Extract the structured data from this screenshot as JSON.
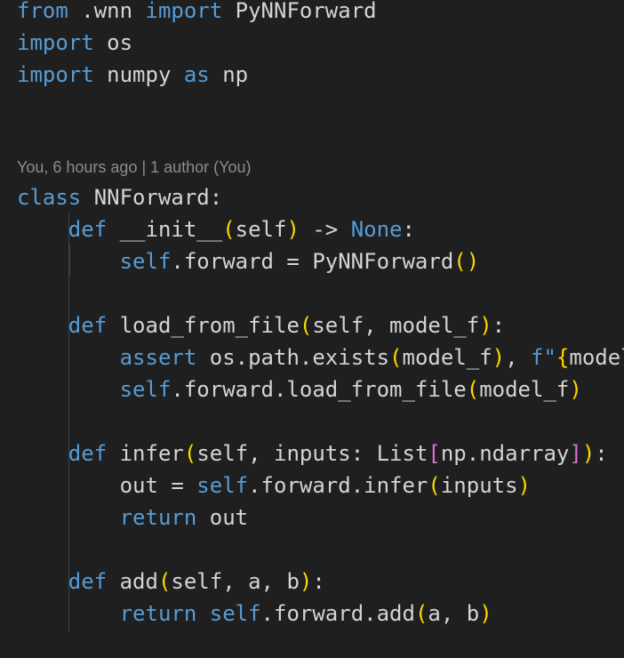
{
  "blame_annotation": "You, 6 hours ago | 1 author (You)",
  "code_lines": [
    {
      "tokens": [
        {
          "t": "from",
          "c": "kw"
        },
        {
          "t": " .wnn ",
          "c": "plain"
        },
        {
          "t": "import",
          "c": "kw"
        },
        {
          "t": " PyNNForward",
          "c": "plain"
        }
      ]
    },
    {
      "tokens": [
        {
          "t": "import",
          "c": "kw"
        },
        {
          "t": " os",
          "c": "plain"
        }
      ]
    },
    {
      "tokens": [
        {
          "t": "import",
          "c": "kw"
        },
        {
          "t": " numpy ",
          "c": "plain"
        },
        {
          "t": "as",
          "c": "kw"
        },
        {
          "t": " np",
          "c": "plain"
        }
      ]
    },
    {
      "tokens": [
        {
          "t": "class",
          "c": "kw"
        },
        {
          "t": " NNForward:",
          "c": "plain"
        }
      ]
    },
    {
      "tokens": [
        {
          "t": "    ",
          "c": "plain"
        },
        {
          "t": "def",
          "c": "kw"
        },
        {
          "t": " __init__",
          "c": "plain"
        },
        {
          "t": "(",
          "c": "b1"
        },
        {
          "t": "self",
          "c": "plain"
        },
        {
          "t": ")",
          "c": "b1"
        },
        {
          "t": " -> ",
          "c": "plain"
        },
        {
          "t": "None",
          "c": "kw"
        },
        {
          "t": ":",
          "c": "plain"
        }
      ]
    },
    {
      "tokens": [
        {
          "t": "        ",
          "c": "plain"
        },
        {
          "t": "self",
          "c": "self"
        },
        {
          "t": ".forward = PyNNForward",
          "c": "plain"
        },
        {
          "t": "()",
          "c": "b1"
        }
      ]
    },
    {
      "tokens": []
    },
    {
      "tokens": [
        {
          "t": "    ",
          "c": "plain"
        },
        {
          "t": "def",
          "c": "kw"
        },
        {
          "t": " load_from_file",
          "c": "plain"
        },
        {
          "t": "(",
          "c": "b1"
        },
        {
          "t": "self, model_f",
          "c": "plain"
        },
        {
          "t": ")",
          "c": "b1"
        },
        {
          "t": ":",
          "c": "plain"
        }
      ]
    },
    {
      "tokens": [
        {
          "t": "        ",
          "c": "plain"
        },
        {
          "t": "assert",
          "c": "kw"
        },
        {
          "t": " os.path.exists",
          "c": "plain"
        },
        {
          "t": "(",
          "c": "b1"
        },
        {
          "t": "model_f",
          "c": "plain"
        },
        {
          "t": ")",
          "c": "b1"
        },
        {
          "t": ", ",
          "c": "plain"
        },
        {
          "t": "f\"",
          "c": "kw"
        },
        {
          "t": "{",
          "c": "b1"
        },
        {
          "t": "model",
          "c": "plain"
        }
      ]
    },
    {
      "tokens": [
        {
          "t": "        ",
          "c": "plain"
        },
        {
          "t": "self",
          "c": "self"
        },
        {
          "t": ".forward.load_from_file",
          "c": "plain"
        },
        {
          "t": "(",
          "c": "b1"
        },
        {
          "t": "model_f",
          "c": "plain"
        },
        {
          "t": ")",
          "c": "b1"
        }
      ]
    },
    {
      "tokens": []
    },
    {
      "tokens": [
        {
          "t": "    ",
          "c": "plain"
        },
        {
          "t": "def",
          "c": "kw"
        },
        {
          "t": " infer",
          "c": "plain"
        },
        {
          "t": "(",
          "c": "b1"
        },
        {
          "t": "self, inputs: List",
          "c": "plain"
        },
        {
          "t": "[",
          "c": "b2"
        },
        {
          "t": "np.ndarray",
          "c": "plain"
        },
        {
          "t": "]",
          "c": "b2"
        },
        {
          "t": ")",
          "c": "b1"
        },
        {
          "t": ":",
          "c": "plain"
        }
      ]
    },
    {
      "tokens": [
        {
          "t": "        out = ",
          "c": "plain"
        },
        {
          "t": "self",
          "c": "self"
        },
        {
          "t": ".forward.infer",
          "c": "plain"
        },
        {
          "t": "(",
          "c": "b1"
        },
        {
          "t": "inputs",
          "c": "plain"
        },
        {
          "t": ")",
          "c": "b1"
        }
      ]
    },
    {
      "tokens": [
        {
          "t": "        ",
          "c": "plain"
        },
        {
          "t": "return",
          "c": "kw"
        },
        {
          "t": " out",
          "c": "plain"
        }
      ]
    },
    {
      "tokens": []
    },
    {
      "tokens": [
        {
          "t": "    ",
          "c": "plain"
        },
        {
          "t": "def",
          "c": "kw"
        },
        {
          "t": " add",
          "c": "plain"
        },
        {
          "t": "(",
          "c": "b1"
        },
        {
          "t": "self, a, b",
          "c": "plain"
        },
        {
          "t": ")",
          "c": "b1"
        },
        {
          "t": ":",
          "c": "plain"
        }
      ]
    },
    {
      "tokens": [
        {
          "t": "        ",
          "c": "plain"
        },
        {
          "t": "return",
          "c": "kw"
        },
        {
          "t": " ",
          "c": "plain"
        },
        {
          "t": "self",
          "c": "self"
        },
        {
          "t": ".forward.add",
          "c": "plain"
        },
        {
          "t": "(",
          "c": "b1"
        },
        {
          "t": "a, b",
          "c": "plain"
        },
        {
          "t": ")",
          "c": "b1"
        }
      ]
    }
  ],
  "colors": {
    "background": "#1f1f1f",
    "keyword": "#569cd6",
    "plain": "#d4d4d4",
    "bracket_level1": "#ffd700",
    "bracket_level2": "#da70d6",
    "codelens": "#8c8c8c",
    "indent_guide": "#404040"
  }
}
